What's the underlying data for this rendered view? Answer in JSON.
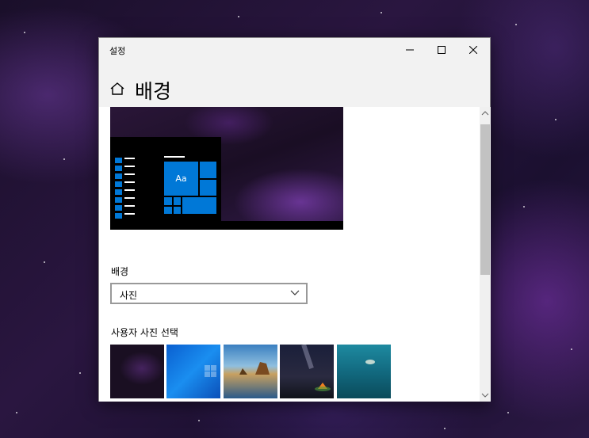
{
  "window": {
    "title": "설정"
  },
  "header": {
    "title": "배경"
  },
  "preview": {
    "tile_text": "Aa"
  },
  "background": {
    "label": "배경",
    "selected": "사진"
  },
  "photos": {
    "label": "사용자 사진 선택"
  },
  "colors": {
    "accent": "#0078d7"
  },
  "icons": [
    "home-icon",
    "minimize-icon",
    "maximize-icon",
    "close-icon",
    "chevron-down-icon"
  ]
}
